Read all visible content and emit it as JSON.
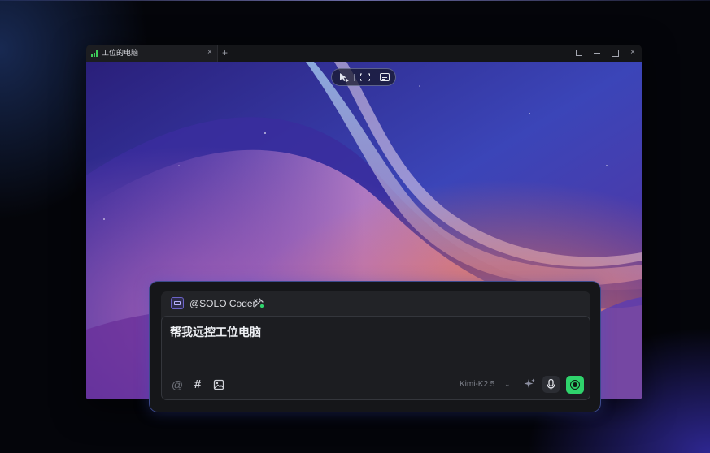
{
  "window": {
    "tab_title": "工位的电脑",
    "tab_close": "×",
    "tab_add": "+",
    "minimize_glyph": "—",
    "close_glyph": "×",
    "icons": [
      "signal-icon",
      "fullscreen-icon",
      "minimize-icon",
      "maximize-icon",
      "close-icon"
    ],
    "signal_color": "#3ecf5a"
  },
  "remote_toolbar": {
    "icons": [
      "pointer-icon",
      "screen-capture-icon",
      "keyboard-icon"
    ]
  },
  "chat": {
    "agent_name": "@SOLO Coder",
    "input_text": "帮我远控工位电脑",
    "at_glyph": "@",
    "hash_glyph": "#",
    "model": "Kimi-K2.5",
    "model_chevron": "⌄",
    "icons": [
      "agent-icon",
      "tools-icon",
      "image-icon",
      "sparkle-icon",
      "mic-icon",
      "record-icon"
    ],
    "accent_color": "#2fd36c",
    "border_color": "#3c4a8c"
  }
}
